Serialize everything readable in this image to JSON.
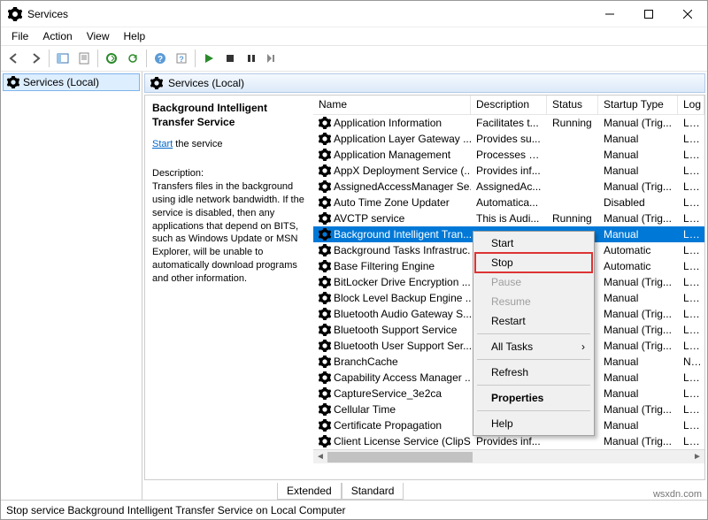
{
  "window": {
    "title": "Services"
  },
  "menu": {
    "file": "File",
    "action": "Action",
    "view": "View",
    "help": "Help"
  },
  "nav": {
    "root": "Services (Local)"
  },
  "main_header": "Services (Local)",
  "detail": {
    "service_name": "Background Intelligent Transfer Service",
    "action_link": "Start",
    "action_suffix": " the service",
    "desc_label": "Description:",
    "desc_text": "Transfers files in the background using idle network bandwidth. If the service is disabled, then any applications that depend on BITS, such as Windows Update or MSN Explorer, will be unable to automatically download programs and other information."
  },
  "columns": {
    "name": "Name",
    "description": "Description",
    "status": "Status",
    "startup": "Startup Type",
    "logon": "Log"
  },
  "rows": [
    {
      "name": "Application Information",
      "desc": "Facilitates t...",
      "status": "Running",
      "startup": "Manual (Trig...",
      "log": "Loca"
    },
    {
      "name": "Application Layer Gateway ...",
      "desc": "Provides su...",
      "status": "",
      "startup": "Manual",
      "log": "Loca"
    },
    {
      "name": "Application Management",
      "desc": "Processes in...",
      "status": "",
      "startup": "Manual",
      "log": "Loca"
    },
    {
      "name": "AppX Deployment Service (...",
      "desc": "Provides inf...",
      "status": "",
      "startup": "Manual",
      "log": "Loca"
    },
    {
      "name": "AssignedAccessManager Se...",
      "desc": "AssignedAc...",
      "status": "",
      "startup": "Manual (Trig...",
      "log": "Loca"
    },
    {
      "name": "Auto Time Zone Updater",
      "desc": "Automatica...",
      "status": "",
      "startup": "Disabled",
      "log": "Loca"
    },
    {
      "name": "AVCTP service",
      "desc": "This is Audi...",
      "status": "Running",
      "startup": "Manual (Trig...",
      "log": "Loca"
    },
    {
      "name": "Background Intelligent Tran...",
      "desc": "",
      "status": "",
      "startup": "Manual",
      "log": "Loca",
      "selected": true
    },
    {
      "name": "Background Tasks Infrastruc...",
      "desc": "",
      "status": "",
      "startup": "Automatic",
      "log": "Loca"
    },
    {
      "name": "Base Filtering Engine",
      "desc": "",
      "status": "",
      "startup": "Automatic",
      "log": "Loca"
    },
    {
      "name": "BitLocker Drive Encryption ...",
      "desc": "",
      "status": "",
      "startup": "Manual (Trig...",
      "log": "Loca"
    },
    {
      "name": "Block Level Backup Engine ...",
      "desc": "",
      "status": "",
      "startup": "Manual",
      "log": "Loca"
    },
    {
      "name": "Bluetooth Audio Gateway S...",
      "desc": "",
      "status": "",
      "startup": "Manual (Trig...",
      "log": "Loca"
    },
    {
      "name": "Bluetooth Support Service",
      "desc": "",
      "status": "",
      "startup": "Manual (Trig...",
      "log": "Loca"
    },
    {
      "name": "Bluetooth User Support Ser...",
      "desc": "",
      "status": "",
      "startup": "Manual (Trig...",
      "log": "Loca"
    },
    {
      "name": "BranchCache",
      "desc": "",
      "status": "",
      "startup": "Manual",
      "log": "Netv"
    },
    {
      "name": "Capability Access Manager ...",
      "desc": "",
      "status": "",
      "startup": "Manual",
      "log": "Loca"
    },
    {
      "name": "CaptureService_3e2ca",
      "desc": "",
      "status": "",
      "startup": "Manual",
      "log": "Loca"
    },
    {
      "name": "Cellular Time",
      "desc": "",
      "status": "",
      "startup": "Manual (Trig...",
      "log": "Loca"
    },
    {
      "name": "Certificate Propagation",
      "desc": "",
      "status": "",
      "startup": "Manual",
      "log": "Loca"
    },
    {
      "name": "Client License Service (ClipS...",
      "desc": "Provides inf...",
      "status": "",
      "startup": "Manual (Trig...",
      "log": "Loca"
    }
  ],
  "context_menu": {
    "start": "Start",
    "stop": "Stop",
    "pause": "Pause",
    "resume": "Resume",
    "restart": "Restart",
    "all_tasks": "All Tasks",
    "refresh": "Refresh",
    "properties": "Properties",
    "help": "Help"
  },
  "tabs": {
    "extended": "Extended",
    "standard": "Standard"
  },
  "statusbar": "Stop service Background Intelligent Transfer Service on Local Computer",
  "watermark": "wsxdn.com"
}
